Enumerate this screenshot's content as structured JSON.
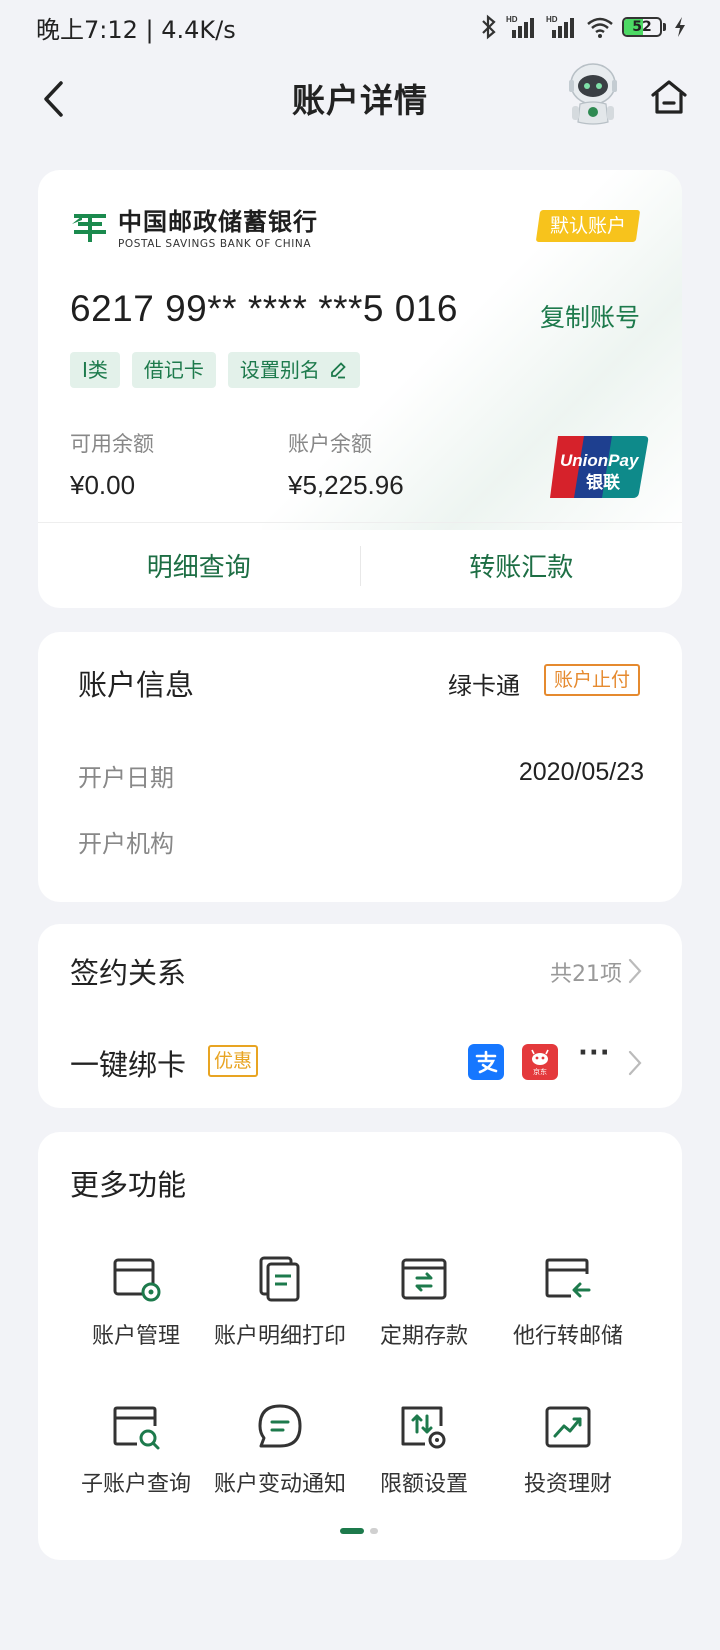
{
  "status_bar": {
    "time_speed": "晚上7:12 | 4.4K/s",
    "battery": "52",
    "battery_level": 0.52
  },
  "nav": {
    "title": "账户详情"
  },
  "account_card": {
    "bank_name_cn": "中国邮政储蓄银行",
    "bank_name_en": "POSTAL SAVINGS BANK OF CHINA",
    "default_badge": "默认账户",
    "card_number": "6217 99** **** ***5 016",
    "copy_label": "复制账号",
    "tags": [
      "Ⅰ类",
      "借记卡",
      "设置别名"
    ],
    "available_label": "可用余额",
    "available_value": "¥0.00",
    "balance_label": "账户余额",
    "balance_value": "¥5,225.96",
    "unionpay_text": "UnionPay",
    "unionpay_cn": "银联",
    "action_detail": "明细查询",
    "action_transfer": "转账汇款"
  },
  "account_info": {
    "title": "账户信息",
    "card_type": "绿卡通",
    "status_badge": "账户止付",
    "open_date_label": "开户日期",
    "open_date_value": "2020/05/23",
    "branch_label": "开户机构",
    "branch_value": ""
  },
  "signing": {
    "title": "签约关系",
    "count": "共21项",
    "bind_title": "一键绑卡",
    "promo_badge": "优惠",
    "jd_label": "京东",
    "more": "···"
  },
  "more_functions": {
    "title": "更多功能",
    "items": [
      {
        "label": "账户管理",
        "icon": "account-manage-icon"
      },
      {
        "label": "账户明细打印",
        "icon": "detail-print-icon"
      },
      {
        "label": "定期存款",
        "icon": "fixed-deposit-icon"
      },
      {
        "label": "他行转邮储",
        "icon": "transfer-in-icon"
      },
      {
        "label": "子账户查询",
        "icon": "sub-account-search-icon"
      },
      {
        "label": "账户变动通知",
        "icon": "change-notify-icon"
      },
      {
        "label": "限额设置",
        "icon": "limit-setting-icon"
      },
      {
        "label": "投资理财",
        "icon": "investment-icon"
      }
    ]
  },
  "colors": {
    "primary_green": "#1d7a4c",
    "badge_yellow": "#f7c31c",
    "warning_orange": "#e58a2f",
    "background": "#f2f3f7"
  }
}
